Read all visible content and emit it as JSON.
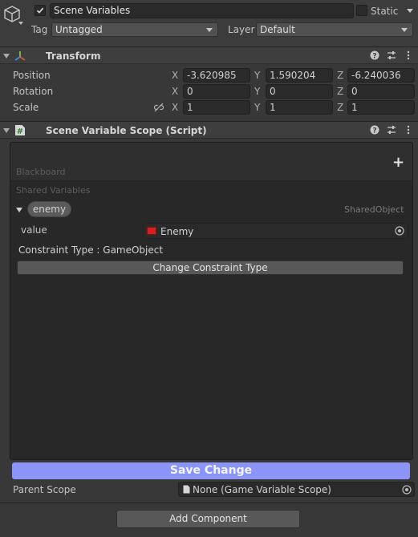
{
  "header": {
    "object_name": "Scene Variables",
    "static_label": "Static",
    "tag_label": "Tag",
    "tag_value": "Untagged",
    "layer_label": "Layer",
    "layer_value": "Default"
  },
  "transform": {
    "title": "Transform",
    "rows": [
      {
        "label": "Position",
        "x": "-3.620985",
        "y": "1.590204",
        "z": "-6.240036"
      },
      {
        "label": "Rotation",
        "x": "0",
        "y": "0",
        "z": "0"
      },
      {
        "label": "Scale",
        "x": "1",
        "y": "1",
        "z": "1"
      }
    ],
    "axis_x": "X",
    "axis_y": "Y",
    "axis_z": "Z"
  },
  "script": {
    "title": "Scene Variable Scope (Script)",
    "blackboard_label": "Blackboard",
    "add_symbol": "+",
    "shared_variables_label": "Shared Variables",
    "variable_name": "enemy",
    "variable_type": "SharedObject",
    "value_label": "value",
    "value_object": "Enemy",
    "constraint_text": "Constraint Type : GameObject",
    "change_constraint_label": "Change Constraint Type",
    "save_label": "Save Change",
    "parent_scope_label": "Parent Scope",
    "parent_scope_value": "None (Game Variable Scope)"
  },
  "add_component_label": "Add Component",
  "colors": {
    "save_button": "#8b94f7",
    "enemy_swatch": "#d42020"
  }
}
